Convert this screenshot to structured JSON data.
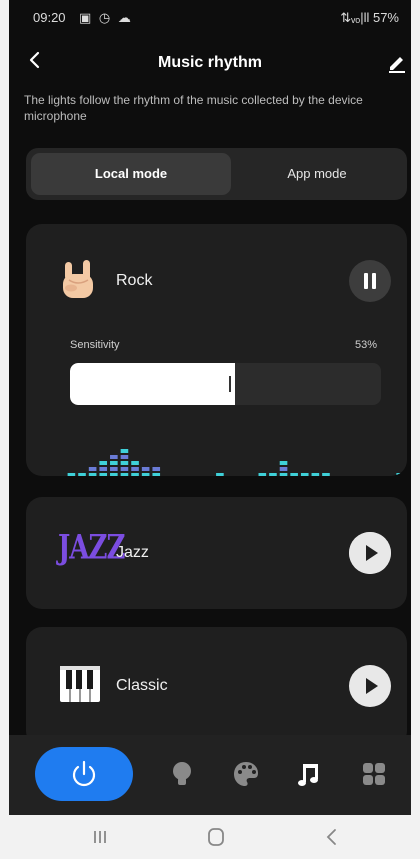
{
  "status_bar": {
    "time": "09:20",
    "left_icons": "▣ ◷ ☁",
    "right": "⇅ᵥₒ|ll 57%"
  },
  "header": {
    "title": "Music rhythm"
  },
  "description": "The lights follow the rhythm of the music collected by the device microphone",
  "modes": {
    "local": "Local mode",
    "app": "App mode",
    "selected": "Local mode"
  },
  "cards": {
    "rock": {
      "name": "Rock",
      "state": "playing",
      "sensitivity_label": "Sensitivity",
      "sensitivity_value": "53%",
      "sensitivity": 0.53,
      "equalizer_levels": [
        0,
        1,
        1,
        2,
        3,
        4,
        5,
        3,
        2,
        2,
        0,
        0,
        0,
        0,
        0,
        1,
        0,
        0,
        0,
        1,
        1,
        3,
        1,
        1,
        1,
        1,
        0,
        0,
        0,
        0,
        0,
        0,
        1
      ],
      "equalizer_colors": [
        "#3fd0d8",
        "#6a7bd6"
      ]
    },
    "jazz": {
      "name": "Jazz",
      "logo_text": "JAZZ",
      "state": "paused"
    },
    "classic": {
      "name": "Classic",
      "state": "paused"
    }
  },
  "bottom_nav": {
    "items": [
      "power-icon",
      "bulb-icon",
      "palette-icon",
      "music-note-icon",
      "scenes-grid-icon"
    ],
    "active": "music-note-icon",
    "accent": "#1f7cf0"
  },
  "android_nav": [
    "recents-icon",
    "home-icon",
    "back-icon"
  ]
}
